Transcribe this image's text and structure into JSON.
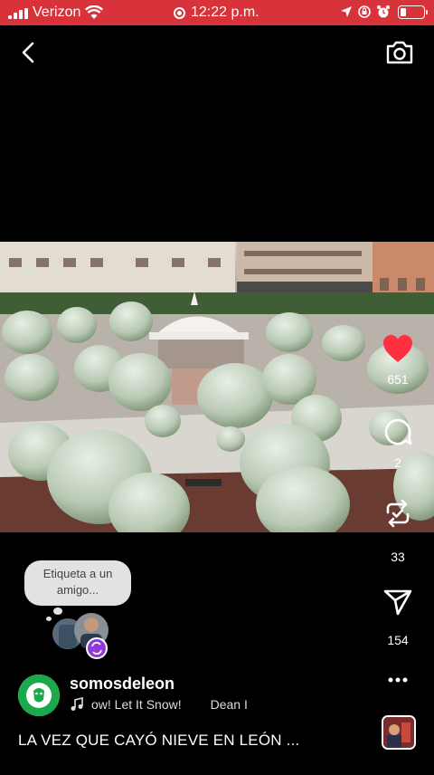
{
  "status_bar": {
    "carrier": "Verizon",
    "time": "12:22 p.m.",
    "background_color": "#d8323b"
  },
  "top_bar": {
    "back_icon": "chevron-left-icon",
    "camera_icon": "camera-icon"
  },
  "actions": {
    "like_count": "651",
    "comment_count": "2",
    "remix_count": "33",
    "share_count": "154",
    "like_color": "#ff3040"
  },
  "sticker": {
    "tag_prompt_line1": "Etiqueta a un",
    "tag_prompt_line2": "amigo..."
  },
  "post": {
    "username": "somosdeleon",
    "song": "ow! Let It Snow!",
    "artist": "Dean I",
    "caption": "LA VEZ QUE CAYÓ NIEVE EN LEÓN ..."
  }
}
